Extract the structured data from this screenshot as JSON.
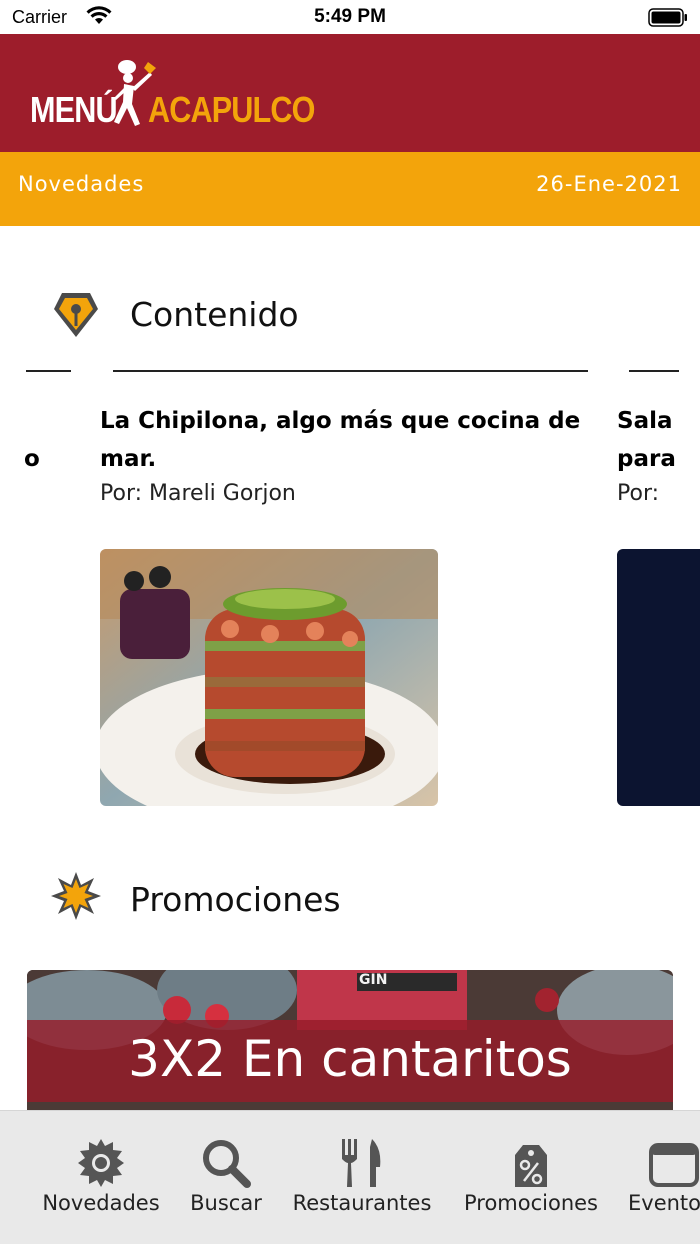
{
  "status_bar": {
    "carrier": "Carrier",
    "time": "5:49 PM"
  },
  "header": {
    "logo_word1": "MENÚ",
    "logo_word2": "ACAPULCO"
  },
  "subheader": {
    "section": "Novedades",
    "date": "26-Ene-2021"
  },
  "contenido": {
    "title": "Contenido",
    "left_fragment": "o",
    "cards": [
      {
        "title": "La Chipilona, algo más que cocina de mar.",
        "author": "Por: Mareli Gorjon"
      },
      {
        "title_line1": "Sala",
        "title_line2": "para",
        "author": "Por:"
      }
    ]
  },
  "promociones": {
    "title": "Promociones",
    "banner_text": "3X2 En cantaritos",
    "banner_sign": "GIN"
  },
  "tab_bar": {
    "items": [
      {
        "label": "Novedades",
        "icon": "gear-icon"
      },
      {
        "label": "Buscar",
        "icon": "search-icon"
      },
      {
        "label": "Restaurantes",
        "icon": "fork-knife-icon"
      },
      {
        "label": "Promociones",
        "icon": "price-tag-icon"
      },
      {
        "label": "Eventos",
        "icon": "calendar-icon"
      }
    ]
  },
  "colors": {
    "brand_red": "#9d1d2b",
    "brand_orange": "#f3a40b",
    "tab_bg": "#e9e9e9"
  }
}
